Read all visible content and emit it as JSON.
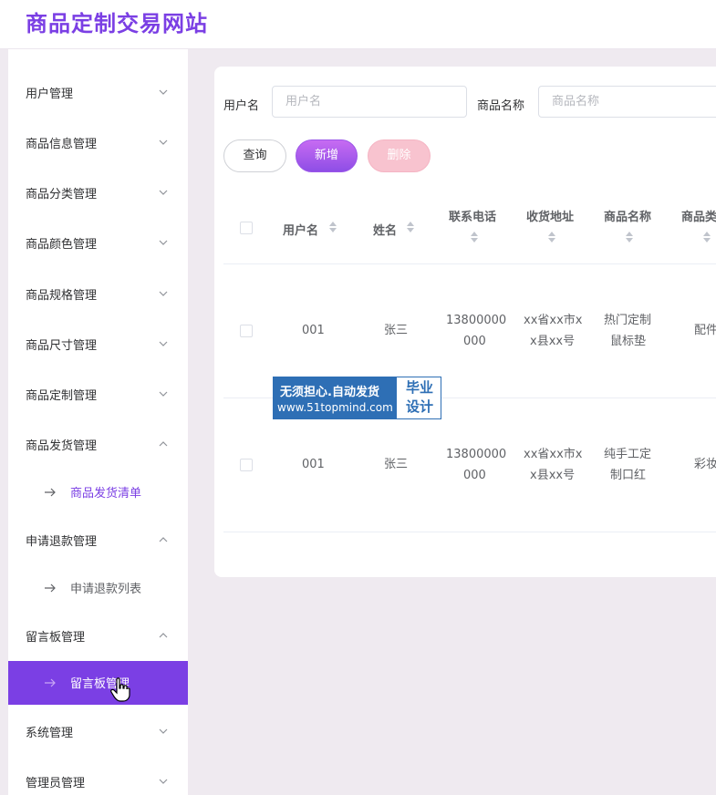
{
  "header": {
    "title": "商品定制交易网站"
  },
  "sidebar": {
    "items": [
      {
        "label": "用户管理",
        "chevron": "chevron-down"
      },
      {
        "label": "商品信息管理",
        "chevron": "chevron-down"
      },
      {
        "label": "商品分类管理",
        "chevron": "chevron-down"
      },
      {
        "label": "商品颜色管理",
        "chevron": "chevron-down"
      },
      {
        "label": "商品规格管理",
        "chevron": "chevron-down"
      },
      {
        "label": "商品尺寸管理",
        "chevron": "chevron-down"
      },
      {
        "label": "商品定制管理",
        "chevron": "chevron-down"
      },
      {
        "label": "商品发货管理",
        "chevron": "chevron-up"
      },
      {
        "label": "申请退款管理",
        "chevron": "chevron-up"
      },
      {
        "label": "留言板管理",
        "chevron": "chevron-up"
      },
      {
        "label": "系统管理",
        "chevron": "chevron-down"
      },
      {
        "label": "管理员管理",
        "chevron": "chevron-down"
      }
    ],
    "sub_items": [
      {
        "label": "商品发货清单"
      },
      {
        "label": "申请退款列表"
      },
      {
        "label": "留言板管理"
      }
    ],
    "accent_color": "#7b3fe4"
  },
  "search": {
    "username_label": "用户名",
    "username_placeholder": "用户名",
    "product_label": "商品名称",
    "product_placeholder": "商品名称"
  },
  "actions": {
    "query": "查询",
    "add": "新增",
    "delete": "删除"
  },
  "table": {
    "headers": [
      "用户名",
      "姓名",
      "联系电话",
      "收货地址",
      "商品名称",
      "商品类"
    ],
    "rows": [
      {
        "username": "001",
        "name": "张三",
        "phone_1": "13800000",
        "phone_2": "000",
        "address_1": "xx省xx市x",
        "address_2": "x县xx号",
        "product_1": "热门定制",
        "product_2": "鼠标垫",
        "category": "配件"
      },
      {
        "username": "001",
        "name": "张三",
        "phone_1": "13800000",
        "phone_2": "000",
        "address_1": "xx省xx市x",
        "address_2": "x县xx号",
        "product_1": "纯手工定",
        "product_2": "制口红",
        "category": "彩妆"
      }
    ]
  },
  "watermark": {
    "line1": "无须担心.自动发货",
    "line2": "www.51topmind.com",
    "badge_1": "毕业",
    "badge_2": "设计"
  }
}
